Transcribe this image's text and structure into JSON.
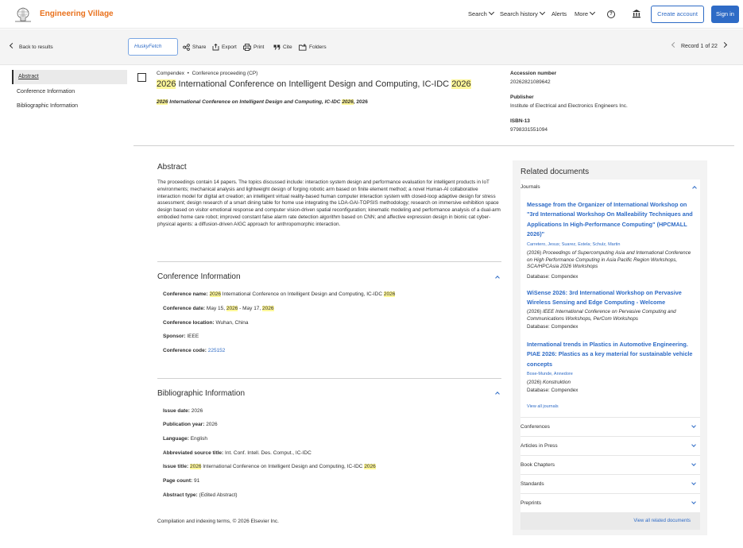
{
  "header": {
    "brand": "Engineering Village",
    "nav": {
      "search": "Search",
      "search_history": "Search history",
      "alerts": "Alerts",
      "more": "More"
    },
    "create_account": "Create account",
    "sign_in": "Sign in",
    "help_glyph": "?"
  },
  "toolbar": {
    "back": "Back to results",
    "huskyfetch": "HuskyFetch",
    "share": "Share",
    "export": "Export",
    "print": "Print",
    "cite": "Cite",
    "folders": "Folders",
    "record": "Record 1 of 22"
  },
  "sidebar": {
    "items": [
      {
        "label": "Abstract"
      },
      {
        "label": "Conference Information"
      },
      {
        "label": "Bibliographic Information"
      }
    ]
  },
  "record": {
    "database": "Compendex",
    "doc_type": "Conference proceeding (CP)",
    "title_year": "2026",
    "title_text": " International Conference on Intelligent Design and Computing, IC-IDC ",
    "title_year_end": "2026",
    "sub_year": "2026",
    "sub_text": " International Conference on Intelligent Design and Computing, IC-IDC ",
    "sub_year_end": "2026",
    "sub_tail": ", 2026",
    "accession_label": "Accession number",
    "accession_value": "20262821089642",
    "publisher_label": "Publisher",
    "publisher_value": "Institute of Electrical and Electronics Engineers Inc.",
    "isbn_label": "ISBN-13",
    "isbn_value": "9798331551094"
  },
  "abstract": {
    "heading": "Abstract",
    "body": "The proceedings contain 14 papers. The topics discussed include: interaction system design and performance evaluation for intelligent products in IoT environments; mechanical analysis and lightweight design of forging robotic arm based on finite element method; a novel Human-AI collaborative interaction model for digital art creation; an intelligent virtual reality-based human computer interaction system with closed-loop adaptive design for stress assessment; design research of a smart dining table for home use integrating the LDA-GAI-TOPSIS methodology; research on immersive exhibition space design based on visitor emotional response and computer vision-driven spatial reconfiguration; kinematic modeling and performance analysis of a dual-arm embodied home care robot; improved constant false alarm rate detection algorithm based on CNN; and affective expression design in bionic cat cyber-physical agents: a diffusion-driven AIGC approach for anthropomorphic interaction."
  },
  "conference": {
    "heading": "Conference Information",
    "name_label": "Conference name:",
    "name_year": "2026",
    "name_text": " International Conference on Intelligent Design and Computing, IC-IDC ",
    "name_year_end": "2026",
    "date_label": "Conference date:",
    "date_a": "May 15, ",
    "date_y1": "2026",
    "date_b": " - May 17, ",
    "date_y2": "2026",
    "location_label": "Conference location:",
    "location_value": "Wuhan, China",
    "sponsor_label": "Sponsor:",
    "sponsor_value": "IEEE",
    "code_label": "Conference code:",
    "code_value": "225152"
  },
  "biblio": {
    "heading": "Bibliographic Information",
    "issue_date_label": "Issue date:",
    "issue_date_value": "2026",
    "pub_year_label": "Publication year:",
    "pub_year_value": "2026",
    "language_label": "Language:",
    "language_value": "English",
    "abbrev_label": "Abbreviated source title:",
    "abbrev_value": "Int. Conf. Intell. Des. Comput., IC-IDC",
    "issue_title_label": "Issue title:",
    "issue_title_year": "2026",
    "issue_title_text": " International Conference on Intelligent Design and Computing, IC-IDC ",
    "issue_title_year_end": "2026",
    "page_count_label": "Page count:",
    "page_count_value": "91",
    "abstract_type_label": "Abstract type:",
    "abstract_type_value": "(Edited Abstract)"
  },
  "copyright": "Compilation and indexing terms, © 2026 Elsevier Inc.",
  "related": {
    "heading": "Related documents",
    "journals_label": "Journals",
    "docs": [
      {
        "title": "Message from the Organizer of International Workshop on \"3rd International Workshop On Malleability Techniques and Applications In High-Performance Computing\" (HPCMALL 2026)\"",
        "authors": "Carretero, Jesus; Suarez, Estela; Schulz, Martin",
        "year": "(2026) ",
        "source": "Proceedings of Supercomputing Asia and International Conference on High Performance Computing in Asia Pacific Region Workshops, SCA/HPCAsia 2026 Workshops",
        "database": "Database: Compendex"
      },
      {
        "title": "WiSense 2026: 3rd International Workshop on Pervasive Wireless Sensing and Edge Computing - Welcome",
        "authors": "",
        "year": "(2026) ",
        "source": "IEEE International Conference on Pervasive Computing and Communications Workshops, PerCom Workshops",
        "database": "Database: Compendex"
      },
      {
        "title": "International trends in Plastics in Automotive Engineering. PIAE 2026: Plastics as a key material for sustainable vehicle concepts",
        "authors": "Bose-Munde, Annedore",
        "year": "(2026) ",
        "source": "Konstruktion",
        "database": "Database: Compendex"
      }
    ],
    "view_all_journals": "View all journals",
    "categories": [
      "Conferences",
      "Articles in Press",
      "Book Chapters",
      "Standards",
      "Preprints"
    ],
    "view_all": "View all related documents"
  },
  "colors": {
    "brand": "#e9711c",
    "link": "#2e6bc6",
    "highlight": "#fff799"
  }
}
